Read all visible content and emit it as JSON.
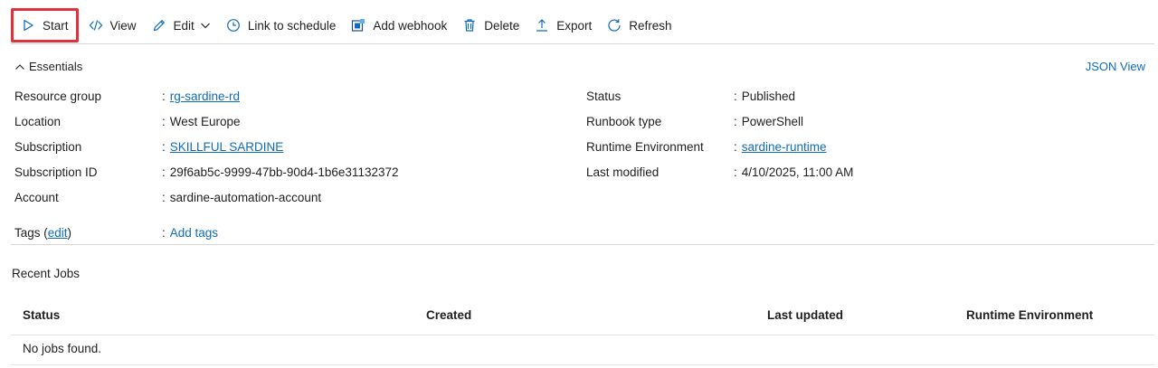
{
  "toolbar": {
    "start": "Start",
    "view": "View",
    "edit": "Edit",
    "link_schedule": "Link to schedule",
    "add_webhook": "Add webhook",
    "delete": "Delete",
    "export": "Export",
    "refresh": "Refresh"
  },
  "essentials": {
    "title": "Essentials",
    "json_view": "JSON View",
    "left": {
      "resource_group_label": "Resource group",
      "resource_group_value": "rg-sardine-rd",
      "location_label": "Location",
      "location_value": "West Europe",
      "subscription_label": "Subscription",
      "subscription_value": "SKILLFUL SARDINE",
      "subscription_id_label": "Subscription ID",
      "subscription_id_value": "29f6ab5c-9999-47bb-90d4-1b6e31132372",
      "account_label": "Account",
      "account_value": "sardine-automation-account"
    },
    "right": {
      "status_label": "Status",
      "status_value": "Published",
      "runbook_type_label": "Runbook type",
      "runbook_type_value": "PowerShell",
      "runtime_env_label": "Runtime Environment",
      "runtime_env_value": "sardine-runtime",
      "last_modified_label": "Last modified",
      "last_modified_value": "4/10/2025, 11:00 AM"
    },
    "tags_label": "Tags (",
    "tags_edit": "edit",
    "tags_close": ")",
    "tags_value": "Add tags",
    "colon": ":"
  },
  "recent_jobs": {
    "title": "Recent Jobs",
    "columns": [
      "Status",
      "Created",
      "Last updated",
      "Runtime Environment"
    ],
    "empty": "No jobs found."
  },
  "colors": {
    "accent": "#0f6cbd",
    "highlight": "#e0323a"
  }
}
